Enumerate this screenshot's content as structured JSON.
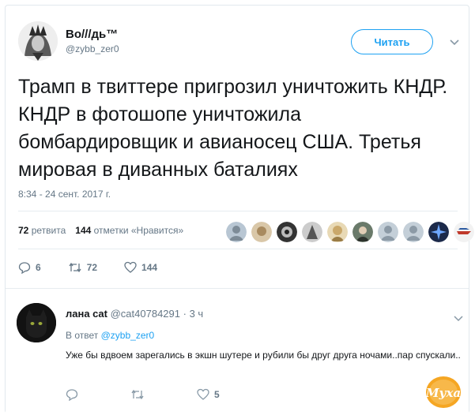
{
  "tweet": {
    "name": "Во///дь™",
    "handle": "@zybb_zer0",
    "follow_label": "Читать",
    "text": "Трамп в твиттере пригрозил уничтожить КНДР. КНДР в фотошопе уничтожила бомбардировщик и авианосец США. Третья мировая в диванных баталиях",
    "timestamp": "8:34 - 24 сент. 2017 г.",
    "stats": {
      "retweets_count": "72",
      "retweets_label": "ретвита",
      "likes_count": "144",
      "likes_label": "отметки «Нравится»"
    },
    "actions": {
      "reply_count": "6",
      "retweet_count": "72",
      "like_count": "144"
    }
  },
  "reply": {
    "name": "лана cat",
    "handle": "@cat40784291",
    "separator": "·",
    "time": "3 ч",
    "reply_to_prefix": "В ответ",
    "reply_to_handle": "@zybb_zer0",
    "text": "Уже бы вдвоем зарегались в экшн шутере и рубили бы друг друга ночами..пар спускали..",
    "actions": {
      "reply_count": "",
      "retweet_count": "",
      "like_count": "5"
    }
  },
  "watermark_text": "Муха",
  "colors": {
    "accent": "#1da1f2",
    "text_primary": "#14171a",
    "text_secondary": "#657786",
    "border": "#e6ecf0"
  },
  "icons": {
    "chevron": "chevron-down-icon",
    "reply": "reply-icon",
    "retweet": "retweet-icon",
    "like": "heart-icon"
  }
}
